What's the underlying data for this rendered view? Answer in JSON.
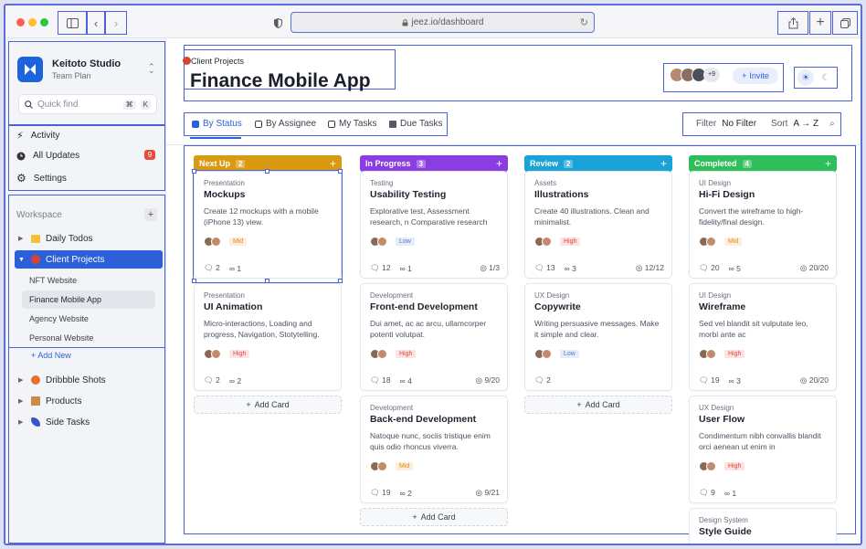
{
  "browser": {
    "url": "jeez.io/dashboard"
  },
  "workspace": {
    "name": "Keitoto Studio",
    "plan": "Team Plan",
    "logo_letter": "K"
  },
  "search": {
    "placeholder": "Quick find",
    "kbd1": "⌘",
    "kbd2": "K"
  },
  "nav": [
    {
      "label": "Activity",
      "icon": "bolt-icon"
    },
    {
      "label": "All Updates",
      "icon": "clock-icon",
      "badge": "9"
    },
    {
      "label": "Settings",
      "icon": "gear-icon"
    }
  ],
  "sidebar": {
    "workspace_label": "Workspace",
    "items": [
      {
        "label": "Daily Todos",
        "color": "#f2c230"
      },
      {
        "label": "Client Projects",
        "color": "#d6452f"
      },
      {
        "label": "Dribbble Shots",
        "color": "#e8702a"
      },
      {
        "label": "Products",
        "color": "#c98a4a"
      },
      {
        "label": "Side Tasks",
        "color": "#3a55c7"
      }
    ],
    "sub_items": [
      "NFT Website",
      "Finance Mobile App",
      "Agency Website",
      "Personal Website"
    ],
    "add_new": "Add New"
  },
  "header": {
    "breadcrumb": "Client Projects",
    "title": "Finance Mobile App",
    "avatar_more": "+9",
    "invite": "Invite"
  },
  "tabs": [
    "By Status",
    "By Assignee",
    "My Tasks",
    "Due Tasks"
  ],
  "filters": {
    "filter_label": "Filter",
    "filter_value": "No Filter",
    "sort_label": "Sort",
    "sort_value": "A → Z"
  },
  "add_card": "Add Card",
  "columns": [
    {
      "title": "Next Up",
      "count": "2",
      "color": "#d99a12",
      "cards": [
        {
          "category": "Presentation",
          "title": "Mockups",
          "desc": "Create 12 mockups with a mobile (iPhone 13) view.",
          "priority": "Mid",
          "comments": "2",
          "links": "1",
          "progress": ""
        },
        {
          "category": "Presentation",
          "title": "UI Animation",
          "desc": "Micro-interactions, Loading and progress, Navigation, Stotytelling.",
          "priority": "High",
          "comments": "2",
          "links": "2",
          "progress": ""
        }
      ]
    },
    {
      "title": "In Progress",
      "count": "3",
      "color": "#8a3de0",
      "cards": [
        {
          "category": "Testing",
          "title": "Usability Testing",
          "desc": "Explorative test, Assessment research, n Comparative research",
          "priority": "Low",
          "comments": "12",
          "links": "1",
          "progress": "1/3"
        },
        {
          "category": "Development",
          "title": "Front-end Development",
          "desc": "Dui amet, ac ac arcu, ullamcorper potenti volutpat.",
          "priority": "High",
          "comments": "18",
          "links": "4",
          "progress": "9/20"
        },
        {
          "category": "Development",
          "title": "Back-end Development",
          "desc": "Natoque nunc, sociis tristique enim quis odio rhoncus viverra.",
          "priority": "Mid",
          "comments": "19",
          "links": "2",
          "progress": "9/21"
        }
      ]
    },
    {
      "title": "Review",
      "count": "2",
      "color": "#1aa3d9",
      "cards": [
        {
          "category": "Assets",
          "title": "Illustrations",
          "desc": "Create 40 illustrations. Clean and minimalist.",
          "priority": "High",
          "comments": "13",
          "links": "3",
          "progress": "12/12"
        },
        {
          "category": "UX Design",
          "title": "Copywrite",
          "desc": "Writing persuasive messages. Make it simple and clear.",
          "priority": "Low",
          "comments": "2",
          "links": "",
          "progress": ""
        }
      ]
    },
    {
      "title": "Completed",
      "count": "4",
      "color": "#2fbf5a",
      "cards": [
        {
          "category": "UI Design",
          "title": "Hi-Fi Design",
          "desc": "Convert the wireframe to high-fidelity/final design.",
          "priority": "Mid",
          "comments": "20",
          "links": "5",
          "progress": "20/20"
        },
        {
          "category": "UI Design",
          "title": "Wireframe",
          "desc": "Sed vel blandit sit vulputate leo, morbi ante ac",
          "priority": "High",
          "comments": "19",
          "links": "3",
          "progress": "20/20"
        },
        {
          "category": "UX Design",
          "title": "User Flow",
          "desc": "Condimentum nibh convallis blandit orci aenean ut enim in",
          "priority": "High",
          "comments": "9",
          "links": "1",
          "progress": ""
        },
        {
          "category": "Design System",
          "title": "Style Guide",
          "desc": "",
          "priority": "",
          "comments": "",
          "links": "",
          "progress": ""
        }
      ]
    }
  ]
}
